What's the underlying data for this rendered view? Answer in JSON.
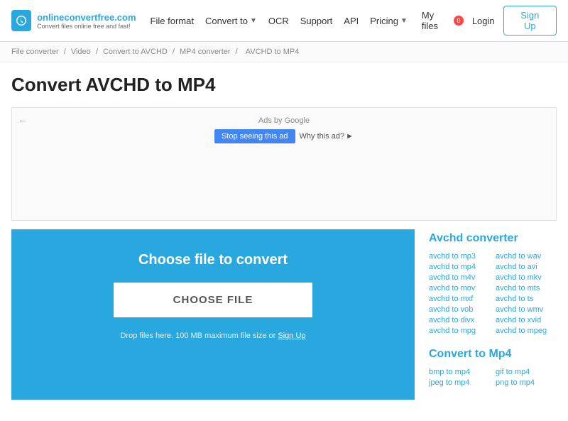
{
  "site": {
    "logo_title": "onlineconvertfree.com",
    "logo_subtitle": "Convert files online free and fast!",
    "nav": [
      {
        "label": "File format",
        "has_arrow": false
      },
      {
        "label": "Convert to",
        "has_arrow": true
      },
      {
        "label": "OCR",
        "has_arrow": false
      },
      {
        "label": "Support",
        "has_arrow": false
      },
      {
        "label": "API",
        "has_arrow": false
      },
      {
        "label": "Pricing",
        "has_arrow": true
      }
    ],
    "my_files_label": "My files",
    "my_files_count": "0",
    "login_label": "Login",
    "signup_label": "Sign Up"
  },
  "breadcrumb": {
    "items": [
      "File converter",
      "Video",
      "Convert to AVCHD",
      "MP4 converter",
      "AVCHD to MP4"
    ]
  },
  "page": {
    "title": "Convert AVCHD to MP4"
  },
  "ad": {
    "label": "Ads by Google",
    "stop_label": "Stop seeing this ad",
    "why_label": "Why this ad?"
  },
  "converter": {
    "title": "Choose file to convert",
    "button_label": "CHOOSE FILE",
    "drop_text": "Drop files here. 100 MB maximum file size or",
    "sign_up_label": "Sign Up"
  },
  "sidebar": {
    "section1_title": "Avchd converter",
    "section1_links": [
      [
        "avchd to mp3",
        "avchd to wav"
      ],
      [
        "avchd to mp4",
        "avchd to avi"
      ],
      [
        "avchd to m4v",
        "avchd to mkv"
      ],
      [
        "avchd to mov",
        "avchd to mts"
      ],
      [
        "avchd to mxf",
        "avchd to ts"
      ],
      [
        "avchd to vob",
        "avchd to wmv"
      ],
      [
        "avchd to divx",
        "avchd to xvid"
      ],
      [
        "avchd to mpg",
        "avchd to mpeg"
      ]
    ],
    "section2_title": "Convert to Mp4",
    "section2_links": [
      [
        "bmp to mp4",
        "gif to mp4"
      ],
      [
        "jpeg to mp4",
        "png to mp4"
      ]
    ]
  }
}
